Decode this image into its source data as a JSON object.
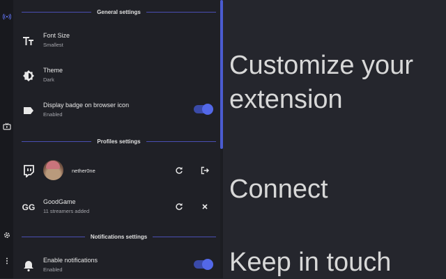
{
  "sections": {
    "general": "General settings",
    "profiles": "Profiles settings",
    "notifications": "Notifications settings"
  },
  "settings": {
    "font_size": {
      "title": "Font Size",
      "value": "Smallest"
    },
    "theme": {
      "title": "Theme",
      "value": "Dark"
    },
    "badge": {
      "title": "Display badge on browser icon",
      "value": "Enabled",
      "enabled": true
    },
    "notifications": {
      "title": "Enable notifications",
      "value": "Enabled",
      "enabled": true
    }
  },
  "profiles": {
    "twitch": {
      "username": "nether0ne"
    },
    "goodgame": {
      "title": "GoodGame",
      "subtitle": "11 streamers added",
      "logo_text": "GG"
    }
  },
  "promo": {
    "line1": "Customize your",
    "line2": "extension",
    "connect": "Connect",
    "keep": "Keep in touch"
  },
  "colors": {
    "accent": "#4a5bd0",
    "panel": "#1f2026",
    "background": "#25262d"
  },
  "icons": [
    "broadcast-icon",
    "tv-icon",
    "gear-icon",
    "more-vertical-icon",
    "font-size-icon",
    "theme-icon",
    "label-icon",
    "twitch-icon",
    "refresh-icon",
    "logout-icon",
    "close-icon",
    "bell-icon"
  ]
}
